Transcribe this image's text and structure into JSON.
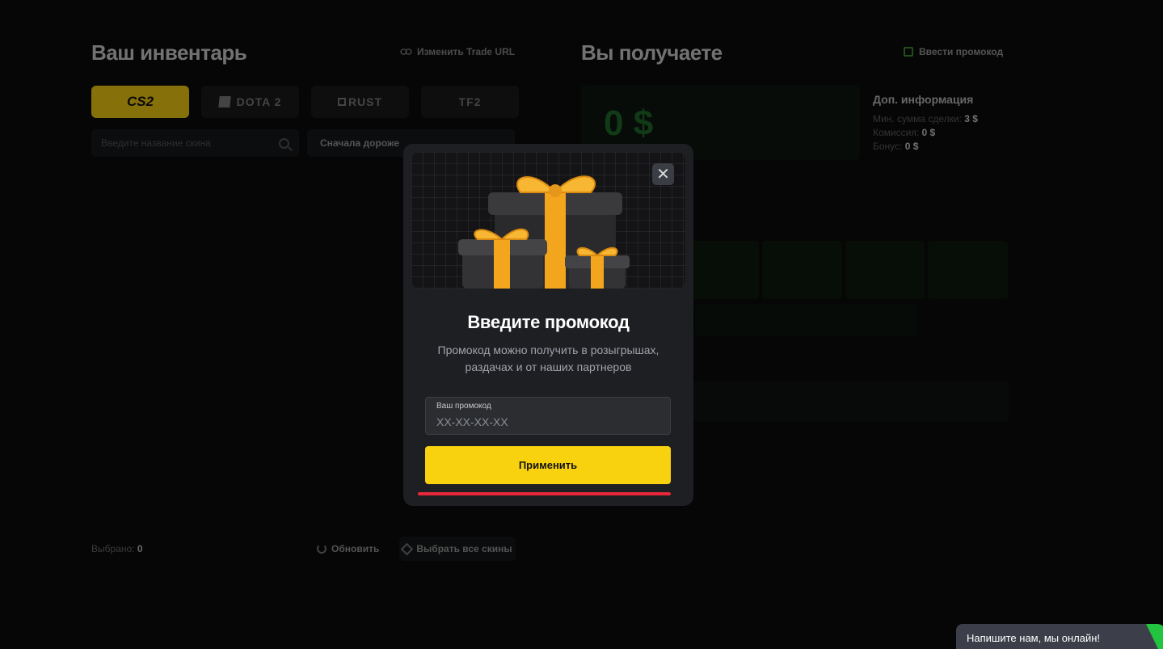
{
  "inventory": {
    "title": "Ваш инвентарь",
    "trade_url_label": "Изменить Trade URL",
    "games": [
      {
        "label": "CS2",
        "icon": "cs2-logo-icon",
        "active": true
      },
      {
        "label": "DOTA 2",
        "icon": "dota2-logo-icon",
        "active": false
      },
      {
        "label": "RUST",
        "icon": "rust-logo-icon",
        "active": false
      },
      {
        "label": "TF2",
        "icon": "tf2-logo-icon",
        "active": false
      }
    ],
    "search_placeholder": "Введите название скина",
    "sort_value": "Сначала дороже",
    "selected_label": "Выбрано:",
    "selected_count": "0",
    "refresh_label": "Обновить",
    "select_all_label": "Выбрать все скины"
  },
  "receive": {
    "title": "Вы получаете",
    "promo_link_label": "Ввести промокод",
    "amount": "0 $",
    "info_title": "Доп. информация",
    "min_sum_label": "Мин. сумма сделки:",
    "min_sum_value": "3 $",
    "commission_label": "Комиссия:",
    "commission_value": "0 $",
    "bonus_label": "Бонус:",
    "bonus_value": "0 $"
  },
  "modal": {
    "title": "Введите промокод",
    "subtitle": "Промокод можно получить в розыгрышах, раздачах и от наших партнеров",
    "input_label": "Ваш промокод",
    "input_placeholder": "XX-XX-XX-XX",
    "apply_label": "Применить",
    "close_glyph": "✕"
  },
  "chat": {
    "label": "Напишите нам, мы онлайн!"
  },
  "colors": {
    "accent_yellow": "#f9d20f",
    "error_red": "#e8283a",
    "online_green": "#23c43f",
    "amount_green": "#1f6a2b"
  }
}
